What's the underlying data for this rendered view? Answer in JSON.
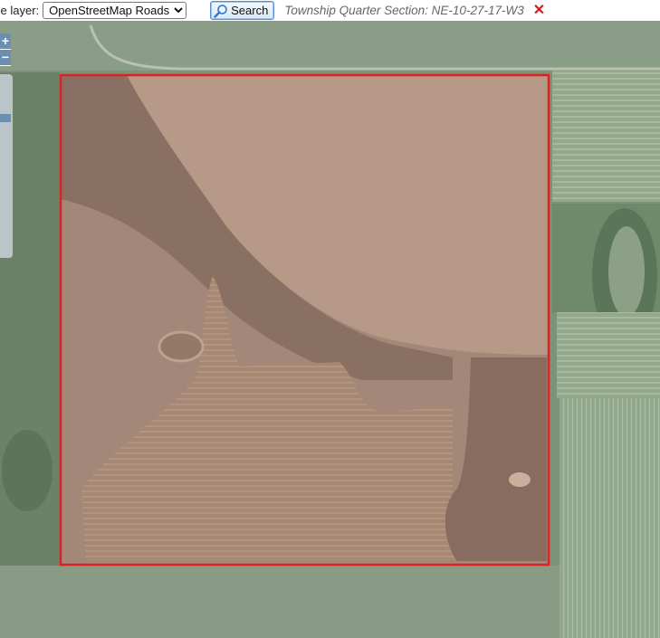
{
  "toolbar": {
    "base_layer_label": "se layer:",
    "base_layer_selected": "OpenStreetMap Roads",
    "search_label": "Search",
    "result_text": "Township Quarter Section: NE-10-27-17-W3",
    "close_symbol": "✕"
  },
  "map": {
    "zoom_in_label": "+",
    "zoom_out_label": "−",
    "boundary_color": "#e02020",
    "icons": [
      "search-icon",
      "close-icon"
    ]
  }
}
